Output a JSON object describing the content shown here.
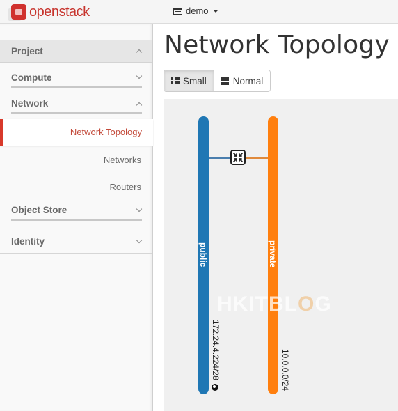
{
  "topbar": {
    "brand": "openstack",
    "project_label": "demo",
    "project_icon": "project-list-icon"
  },
  "sidebar": {
    "dashboard": {
      "label": "Project",
      "expanded": true
    },
    "panels": [
      {
        "label": "Compute",
        "expanded": false
      },
      {
        "label": "Network",
        "expanded": true,
        "items": [
          {
            "label": "Network Topology",
            "active": true
          },
          {
            "label": "Networks",
            "active": false
          },
          {
            "label": "Routers",
            "active": false
          }
        ]
      },
      {
        "label": "Object Store",
        "expanded": false
      }
    ],
    "identity": {
      "label": "Identity",
      "expanded": false
    }
  },
  "main": {
    "title": "Network Topology",
    "view_toggle": [
      {
        "label": "Small",
        "icon": "th-icon",
        "active": true
      },
      {
        "label": "Normal",
        "icon": "th-large-icon",
        "active": false
      }
    ]
  },
  "topology": {
    "networks": [
      {
        "name": "public",
        "cidr": "172.24.4.224/28",
        "color": "#1f77b4",
        "external": true
      },
      {
        "name": "private",
        "cidr": "10.0.0.0/24",
        "color": "#ff7f0e",
        "external": false
      }
    ],
    "router": {
      "icon": "router-icon",
      "connects": [
        "public",
        "private"
      ]
    }
  },
  "watermark": {
    "text_a": "HKITBL",
    "text_b": "O",
    "text_c": "G"
  }
}
